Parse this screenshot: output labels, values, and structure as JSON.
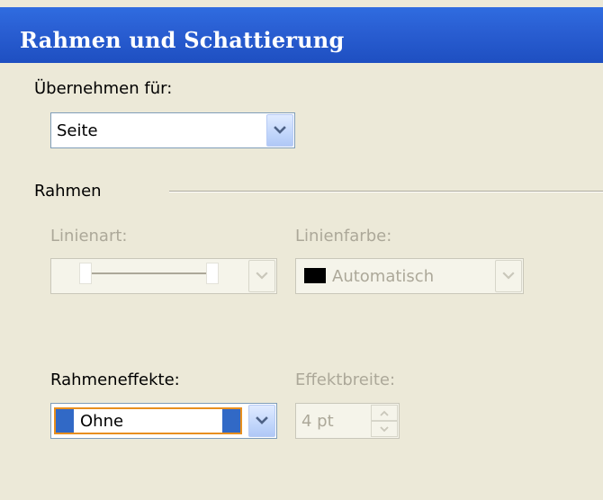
{
  "window": {
    "title": "Rahmen und Schattierung"
  },
  "apply_to": {
    "label": "Übernehmen für:",
    "value": "Seite"
  },
  "border_section": {
    "label": "Rahmen"
  },
  "line_style": {
    "label": "Linienart:"
  },
  "line_color": {
    "label": "Linienfarbe:",
    "value": "Automatisch",
    "swatch_color": "#000000"
  },
  "border_effects": {
    "label": "Rahmeneffekte:",
    "value": "Ohne"
  },
  "effect_width": {
    "label": "Effektbreite:",
    "value": "4 pt"
  },
  "colors": {
    "titlebar": "#2a5fd3",
    "dialog_bg": "#ece9d8",
    "focus_orange": "#e88f1e",
    "selection_blue": "#3169c6"
  }
}
